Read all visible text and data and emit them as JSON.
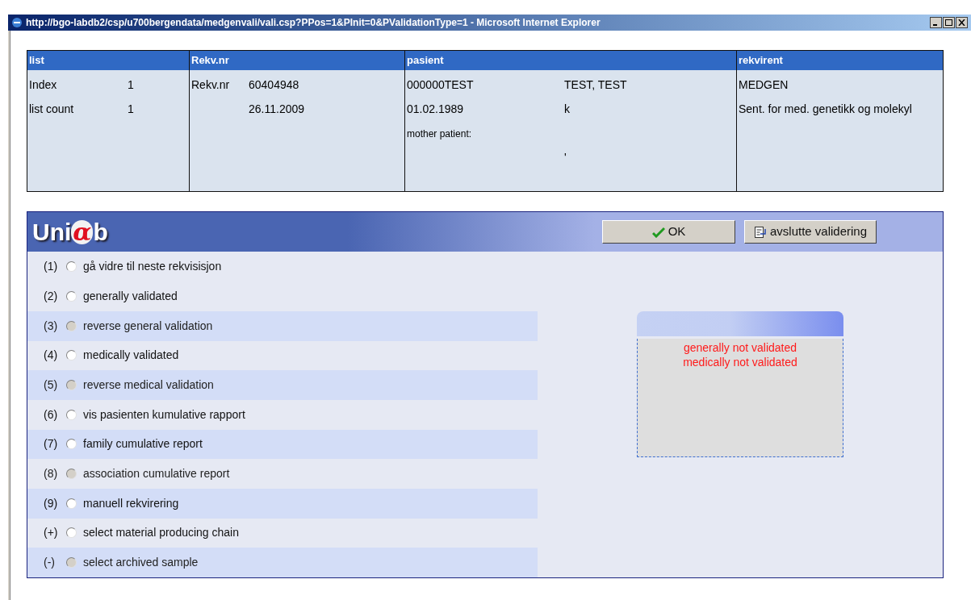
{
  "window": {
    "title": "http://bgo-labdb2/csp/u700bergendata/medgenvali/vali.csp?PPos=1&PInit=0&PValidationType=1 - Microsoft Internet Explorer"
  },
  "info_table": {
    "columns": [
      {
        "heading": "list",
        "rows": [
          {
            "label": "Index",
            "value": "1"
          },
          {
            "label": "list count",
            "value": "1"
          }
        ]
      },
      {
        "heading": "Rekv.nr",
        "rows": [
          {
            "label": "Rekv.nr",
            "value": "60404948"
          },
          {
            "label": "",
            "value": "26.11.2009"
          }
        ]
      },
      {
        "heading": "pasient",
        "rows": [
          {
            "label": "000000TEST",
            "value": "TEST, TEST"
          },
          {
            "label": "01.02.1989",
            "value": "k"
          },
          {
            "label": "mother patient:",
            "value": ""
          },
          {
            "label": "",
            "value": "'"
          }
        ]
      },
      {
        "heading": "rekvirent",
        "rows": [
          {
            "label": "MEDGEN",
            "value": ""
          },
          {
            "label": "Sent. for med. genetikk og molekyl",
            "value": ""
          }
        ]
      }
    ]
  },
  "panel": {
    "logo": {
      "prefix": "Uni",
      "alpha": "α",
      "suffix": "b"
    },
    "buttons": [
      {
        "kind": "ok",
        "label": "OK"
      },
      {
        "kind": "exit",
        "label": "avslutte validering"
      }
    ],
    "options": [
      {
        "key": "(1)",
        "label": "gå vidre til neste rekvisisjon",
        "disabled": false,
        "selected": false
      },
      {
        "key": "(2)",
        "label": "generally validated",
        "disabled": false,
        "selected": false
      },
      {
        "key": "(3)",
        "label": "reverse general validation",
        "disabled": true,
        "selected": false
      },
      {
        "key": "(4)",
        "label": "medically validated",
        "disabled": false,
        "selected": false
      },
      {
        "key": "(5)",
        "label": "reverse medical validation",
        "disabled": true,
        "selected": false
      },
      {
        "key": "(6)",
        "label": "vis pasienten kumulative rapport",
        "disabled": false,
        "selected": false
      },
      {
        "key": "(7)",
        "label": "family cumulative report",
        "disabled": false,
        "selected": false
      },
      {
        "key": "(8)",
        "label": "association cumulative report",
        "disabled": true,
        "selected": false
      },
      {
        "key": "(9)",
        "label": "manuell rekvirering",
        "disabled": false,
        "selected": false
      },
      {
        "key": "(+)",
        "label": "select material producing chain",
        "disabled": false,
        "selected": false
      },
      {
        "key": "(-)",
        "label": "select archived sample",
        "disabled": true,
        "selected": false
      }
    ],
    "status": [
      "generally not validated",
      "medically not validated"
    ]
  }
}
